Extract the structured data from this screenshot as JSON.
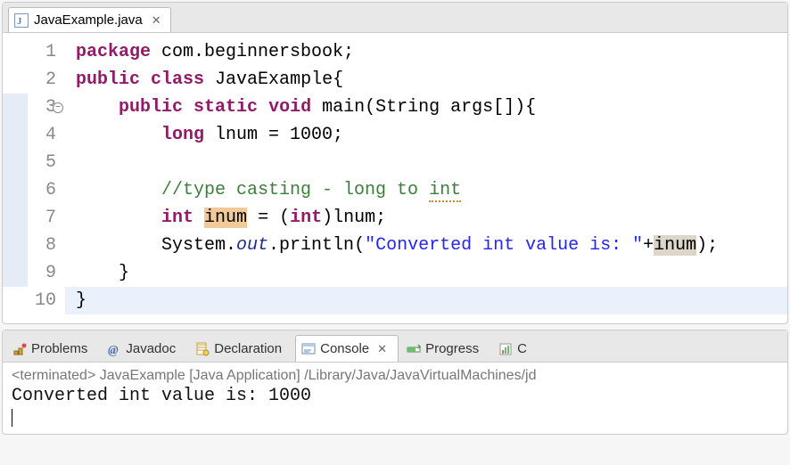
{
  "editor": {
    "tab_filename": "JavaExample.java",
    "fold_line": 3,
    "lines": [
      {
        "n": 1,
        "segs": [
          {
            "t": "package",
            "c": "kw"
          },
          {
            "t": " com.beginnersbook;"
          }
        ],
        "hl": false
      },
      {
        "n": 2,
        "segs": [
          {
            "t": "public",
            "c": "kw"
          },
          {
            "t": " "
          },
          {
            "t": "class",
            "c": "kw"
          },
          {
            "t": " JavaExample{"
          }
        ],
        "hl": false
      },
      {
        "n": 3,
        "segs": [
          {
            "t": "    "
          },
          {
            "t": "public",
            "c": "kw"
          },
          {
            "t": " "
          },
          {
            "t": "static",
            "c": "kw"
          },
          {
            "t": " "
          },
          {
            "t": "void",
            "c": "kw"
          },
          {
            "t": " main(String args[]){"
          }
        ],
        "hl": true
      },
      {
        "n": 4,
        "segs": [
          {
            "t": "        "
          },
          {
            "t": "long",
            "c": "kw"
          },
          {
            "t": " lnum = 1000;"
          }
        ],
        "hl": true
      },
      {
        "n": 5,
        "segs": [],
        "hl": true
      },
      {
        "n": 6,
        "segs": [
          {
            "t": "        "
          },
          {
            "t": "//type casting - long to ",
            "c": "cmt"
          },
          {
            "t": "int",
            "c": "cmt dotted-under"
          }
        ],
        "hl": true
      },
      {
        "n": 7,
        "segs": [
          {
            "t": "        "
          },
          {
            "t": "int",
            "c": "kw"
          },
          {
            "t": " "
          },
          {
            "t": "inum",
            "c": "hl-word1"
          },
          {
            "t": " = ("
          },
          {
            "t": "int",
            "c": "kw"
          },
          {
            "t": ")lnum;"
          }
        ],
        "hl": true
      },
      {
        "n": 8,
        "segs": [
          {
            "t": "        System."
          },
          {
            "t": "out",
            "c": "fld"
          },
          {
            "t": ".println("
          },
          {
            "t": "\"Converted int value is: \"",
            "c": "str"
          },
          {
            "t": "+"
          },
          {
            "t": "inum",
            "c": "hl-word2"
          },
          {
            "t": ");"
          }
        ],
        "hl": true
      },
      {
        "n": 9,
        "segs": [
          {
            "t": "    }"
          }
        ],
        "hl": true
      },
      {
        "n": 10,
        "segs": [
          {
            "t": "}"
          }
        ],
        "hl": false,
        "cursor": true
      }
    ]
  },
  "console": {
    "tabs": [
      {
        "label": "Problems",
        "icon": "problems"
      },
      {
        "label": "Javadoc",
        "icon": "javadoc"
      },
      {
        "label": "Declaration",
        "icon": "declaration"
      },
      {
        "label": "Console",
        "icon": "console",
        "active": true
      },
      {
        "label": "Progress",
        "icon": "progress"
      },
      {
        "label": "C",
        "icon": "coverage"
      }
    ],
    "terminated_text": "<terminated> JavaExample [Java Application] /Library/Java/JavaVirtualMachines/jd",
    "output": "Converted int value is: 1000"
  }
}
